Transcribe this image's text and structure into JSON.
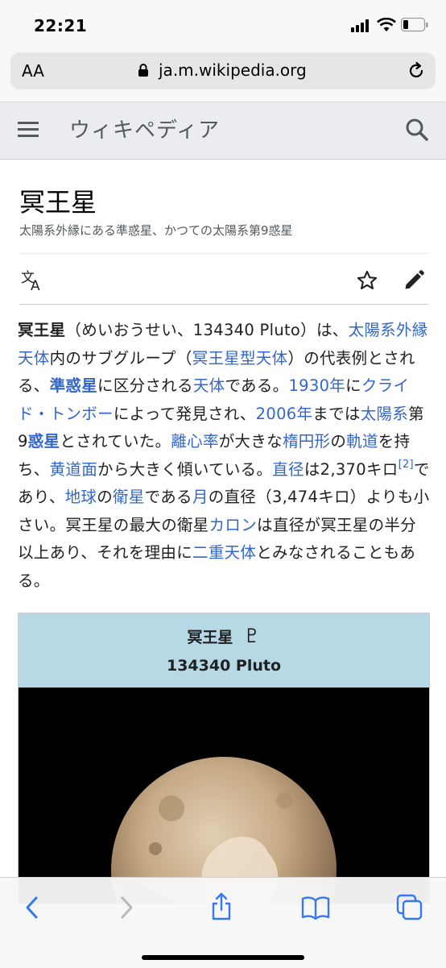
{
  "status": {
    "time": "22:21"
  },
  "browser": {
    "text_size_label": "AA",
    "url": "ja.m.wikipedia.org"
  },
  "wiki": {
    "site_name": "ウィキペディア",
    "title": "冥王星",
    "subtitle": "太陽系外縁にある準惑星、かつての太陽系第9惑星"
  },
  "article": {
    "intro": [
      {
        "t": "冥王星",
        "b": true
      },
      {
        "t": "（めいおうせい、134340 Pluto）は、"
      },
      {
        "t": "太陽系外縁天体",
        "link": true
      },
      {
        "t": "内のサブグループ（"
      },
      {
        "t": "冥王星型天体",
        "link": true
      },
      {
        "t": "）の代表例とされる、"
      },
      {
        "t": "準惑星",
        "link": true,
        "b": true
      },
      {
        "t": "に区分される"
      },
      {
        "t": "天体",
        "link": true
      },
      {
        "t": "である。"
      },
      {
        "t": "1930年",
        "link": true
      },
      {
        "t": "に"
      },
      {
        "t": "クライド・トンボー",
        "link": true
      },
      {
        "t": "によって発見され、"
      },
      {
        "t": "2006年",
        "link": true
      },
      {
        "t": "までは"
      },
      {
        "t": "太陽系",
        "link": true
      },
      {
        "t": "第9"
      },
      {
        "t": "惑星",
        "link": true,
        "b": true
      },
      {
        "t": "とされていた。"
      },
      {
        "t": "離心率",
        "link": true
      },
      {
        "t": "が大きな"
      },
      {
        "t": "楕円形",
        "link": true
      },
      {
        "t": "の"
      },
      {
        "t": "軌道",
        "link": true
      },
      {
        "t": "を持ち、"
      },
      {
        "t": "黄道面",
        "link": true
      },
      {
        "t": "から大きく傾いている。"
      },
      {
        "t": "直径",
        "link": true
      },
      {
        "t": "は2,370キロ"
      },
      {
        "t": "[2]",
        "link": true,
        "sup": true
      },
      {
        "t": "であり、"
      },
      {
        "t": "地球",
        "link": true
      },
      {
        "t": "の"
      },
      {
        "t": "衛星",
        "link": true
      },
      {
        "t": "である"
      },
      {
        "t": "月",
        "link": true
      },
      {
        "t": "の直径（3,474キロ）よりも小さい。冥王星の最大の衛星"
      },
      {
        "t": "カロン",
        "link": true
      },
      {
        "t": "は直径が冥王星の半分以上あり、それを理由に"
      },
      {
        "t": "二重天体",
        "link": true
      },
      {
        "t": "とみなされることもある。"
      }
    ]
  },
  "infobox": {
    "title": "冥王星",
    "symbol": "♇",
    "subtitle": "134340 Pluto"
  },
  "icons": {
    "menu": "menu-icon",
    "search": "search-icon",
    "language": "language-icon",
    "star": "star-icon",
    "edit": "pencil-icon",
    "back": "chevron-left-icon",
    "forward": "chevron-right-icon",
    "share": "share-icon",
    "bookmarks": "book-icon",
    "tabs": "tabs-icon"
  },
  "colors": {
    "link": "#3366cc",
    "infobox_header": "#b7d9e6",
    "ios_blue": "#3478f6"
  }
}
